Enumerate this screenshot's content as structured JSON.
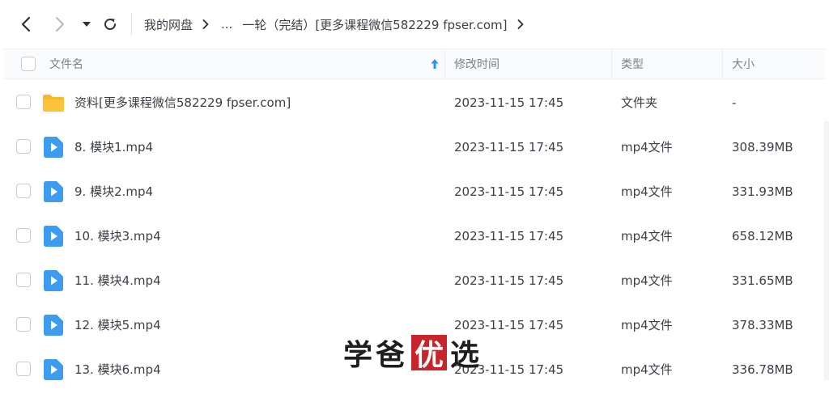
{
  "breadcrumb": {
    "root": "我的网盘",
    "ellipsis": "...",
    "current": "一轮（完结）[更多课程微信582229 fpser.com]"
  },
  "table": {
    "columns": {
      "name": "文件名",
      "modified": "修改时间",
      "type": "类型",
      "size": "大小"
    },
    "sort": "name-ascending",
    "rows": [
      {
        "icon": "folder-icon",
        "name": "资料[更多课程微信582229 fpser.com]",
        "modified": "2023-11-15 17:45",
        "type": "文件夹",
        "size": "-"
      },
      {
        "icon": "video-file-icon",
        "name": "8. 模块1.mp4",
        "modified": "2023-11-15 17:45",
        "type": "mp4文件",
        "size": "308.39MB"
      },
      {
        "icon": "video-file-icon",
        "name": "9. 模块2.mp4",
        "modified": "2023-11-15 17:45",
        "type": "mp4文件",
        "size": "331.93MB"
      },
      {
        "icon": "video-file-icon",
        "name": "10. 模块3.mp4",
        "modified": "2023-11-15 17:45",
        "type": "mp4文件",
        "size": "658.12MB"
      },
      {
        "icon": "video-file-icon",
        "name": "11. 模块4.mp4",
        "modified": "2023-11-15 17:45",
        "type": "mp4文件",
        "size": "331.65MB"
      },
      {
        "icon": "video-file-icon",
        "name": "12. 模块5.mp4",
        "modified": "2023-11-15 17:45",
        "type": "mp4文件",
        "size": "378.33MB"
      },
      {
        "icon": "video-file-icon",
        "name": "13. 模块6.mp4",
        "modified": "2023-11-15 17:45",
        "type": "mp4文件",
        "size": "336.78MB"
      }
    ]
  },
  "watermark": {
    "part1": "学爸",
    "part2": "优",
    "part3": "选"
  },
  "colors": {
    "accent": "#2e8ff0",
    "folder": "#f7b928",
    "video": "#3d9bf0",
    "watermark_red": "#c8242b"
  }
}
